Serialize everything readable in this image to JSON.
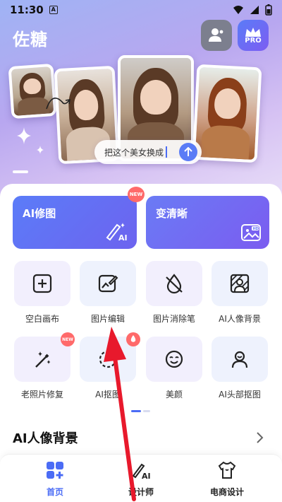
{
  "status_bar": {
    "time": "11:30"
  },
  "header": {
    "app_title": "佐糖",
    "pro_label": "PRO"
  },
  "hero": {
    "prompt_text": "把这个美女换成"
  },
  "feature_cards": [
    {
      "label": "AI修图",
      "badge": "NEW"
    },
    {
      "label": "变清晰",
      "icon_text": "HD"
    }
  ],
  "tools": [
    {
      "label": "空白画布",
      "icon": "plus-square-icon"
    },
    {
      "label": "图片编辑",
      "icon": "image-edit-icon"
    },
    {
      "label": "图片消除笔",
      "icon": "eraser-drop-icon"
    },
    {
      "label": "AI人像背景",
      "icon": "portrait-bg-icon"
    },
    {
      "label": "老照片修复",
      "icon": "magic-wand-icon",
      "badge": "NEW"
    },
    {
      "label": "AI抠图",
      "icon": "cutout-icon",
      "badge": "fire"
    },
    {
      "label": "美颜",
      "icon": "beauty-face-icon"
    },
    {
      "label": "AI头部抠图",
      "icon": "head-cutout-icon"
    }
  ],
  "section": {
    "title": "AI人像背景"
  },
  "tabbar": [
    {
      "label": "首页",
      "active": true
    },
    {
      "label": "设计师",
      "active": false
    },
    {
      "label": "电商设计",
      "active": false
    }
  ],
  "colors": {
    "accent": "#4b6cf5",
    "badge": "#ff6a6a",
    "annotation_arrow": "#e8192c"
  }
}
